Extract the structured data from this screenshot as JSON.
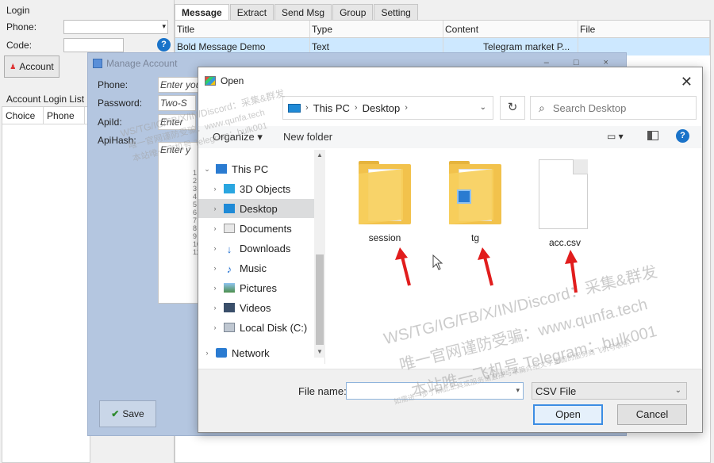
{
  "left": {
    "login_group": "Login",
    "phone_label": "Phone:",
    "code_label": "Code:",
    "help": "?",
    "account_button": "Account",
    "account_list_title": "Account Login List",
    "columns": [
      "Choice",
      "Phone"
    ]
  },
  "tabs": [
    "Message",
    "Extract",
    "Send Msg",
    "Group",
    "Setting"
  ],
  "messages": {
    "columns": [
      "Title",
      "Type",
      "Content",
      "File"
    ],
    "rows": [
      {
        "title": "Bold Message Demo",
        "type": "Text",
        "content": "Telegram market P...",
        "file": ""
      }
    ]
  },
  "manage": {
    "title": "Manage Account",
    "controls": "– □ ×",
    "fields": [
      {
        "label": "Phone:",
        "placeholder": "Enter you"
      },
      {
        "label": "Password:",
        "placeholder": "Two-S"
      },
      {
        "label": "ApiId:",
        "placeholder": "Enter"
      },
      {
        "label": "ApiHash:",
        "placeholder": "Enter y"
      }
    ],
    "line_numbers": "1\n2\n3\n4\n5\n6\n7\n8\n9\n10\n11",
    "save_button": "Save"
  },
  "dialog": {
    "title": "Open",
    "close": "✕",
    "breadcrumb": [
      "This PC",
      "Desktop"
    ],
    "search_placeholder": "Search Desktop",
    "toolbar": {
      "organize": "Organize ▾",
      "new_folder": "New folder",
      "help": "?"
    },
    "nav": [
      {
        "label": "This PC",
        "expanded": true
      },
      {
        "label": "3D Objects"
      },
      {
        "label": "Desktop",
        "selected": true
      },
      {
        "label": "Documents"
      },
      {
        "label": "Downloads"
      },
      {
        "label": "Music"
      },
      {
        "label": "Pictures"
      },
      {
        "label": "Videos"
      },
      {
        "label": "Local Disk (C:)"
      },
      {
        "label": "Network"
      }
    ],
    "files": [
      "session",
      "tg",
      "acc.csv"
    ],
    "file_name_label": "File name:",
    "file_name_value": "",
    "file_type": "CSV File",
    "open_button": "Open",
    "cancel_button": "Cancel"
  },
  "watermark": {
    "line1": "WS/TG/IG/FB/X/IN/Discord：采集&群发",
    "line2": "唯一官网谨防受骗：www.qunfa.tech",
    "line3": "本站唯一飞机号 Telegram：bulk001",
    "line4": "如需进一步了解此工具或服务请直接与本篇介绍文字里面的服务商飞机号联系"
  },
  "colors": {
    "accent": "#1a73c9",
    "selection": "#cde8ff",
    "arrow": "#e11d1d"
  }
}
